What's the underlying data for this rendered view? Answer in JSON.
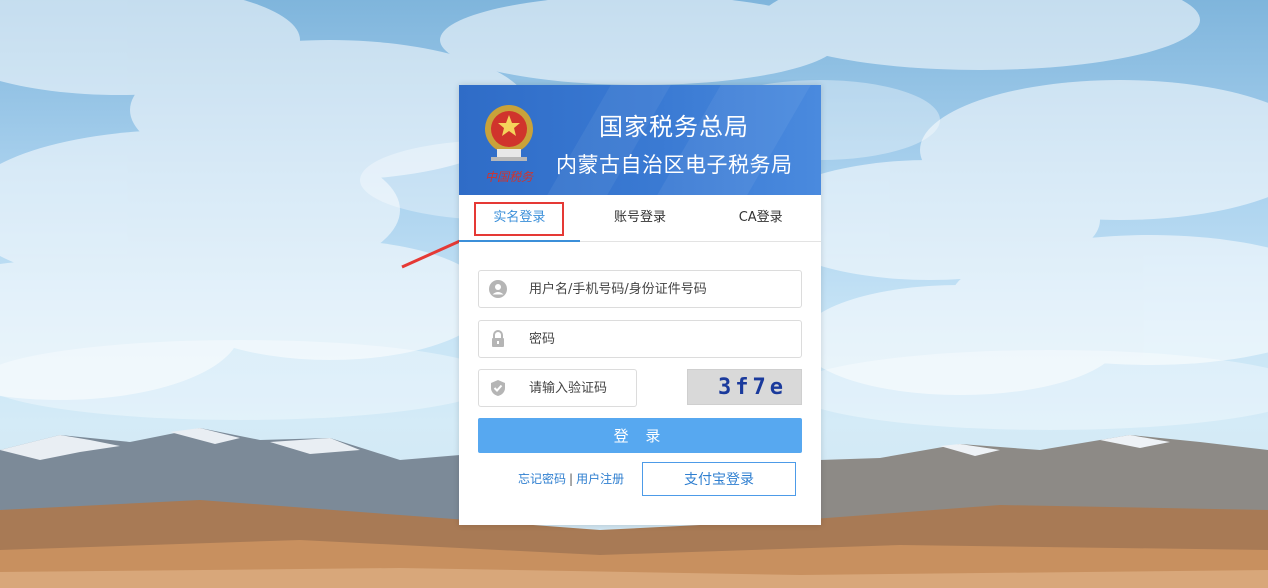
{
  "header": {
    "title": "国家税务总局",
    "subtitle": "内蒙古自治区电子税务局",
    "emblem_text": "中国税务"
  },
  "tabs": [
    {
      "label": "实名登录",
      "active": true
    },
    {
      "label": "账号登录",
      "active": false
    },
    {
      "label": "CA登录",
      "active": false
    }
  ],
  "form": {
    "username_placeholder": "用户名/手机号码/身份证件号码",
    "password_placeholder": "密码",
    "captcha_placeholder": "请输入验证码",
    "captcha_code": "3f7e",
    "login_label": "登 录"
  },
  "links": {
    "forgot_password": "忘记密码",
    "separator": "|",
    "register": "用户注册",
    "alipay_login": "支付宝登录"
  },
  "colors": {
    "accent": "#3b8fd9",
    "login_button": "#57a8f0",
    "header_blue": "#2f6cc7",
    "annotation_red": "#e53935"
  },
  "icons": {
    "username": "user-icon",
    "password": "lock-icon",
    "captcha": "shield-icon"
  }
}
